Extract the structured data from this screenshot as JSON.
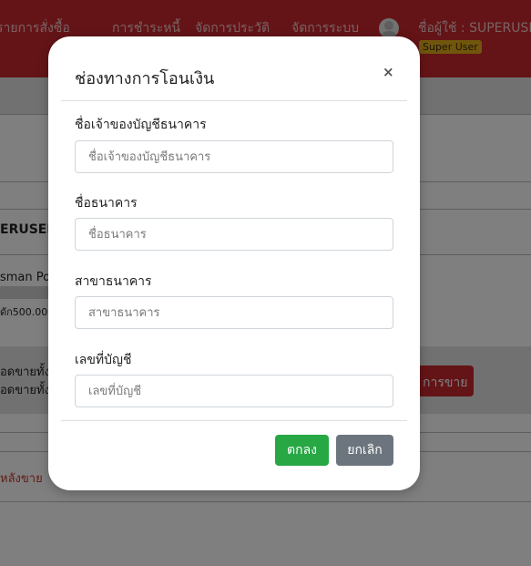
{
  "navbar": {
    "menu": [
      "รายการสั่งซื้อ",
      "การชำระหนี้",
      "จัดการประวัติ",
      "จัดการระบบ"
    ],
    "user_label": "ชื่อผู้ใช้ : SUPERUSER",
    "role_badge": "Super User"
  },
  "background": {
    "username": "ERUSER",
    "sales_person": "sman Po",
    "amount_line": "ดัก500.00",
    "total_line_1": "อดขายทั้ง",
    "total_line_2": "อดขายทั้ง",
    "sales_button": "การขาย",
    "back_link": "หลังขาย"
  },
  "modal": {
    "title": "ช่องทางการโอนเงิน",
    "close_symbol": "×",
    "fields": [
      {
        "label": "ชื่อเจ้าของบัญชีธนาคาร",
        "placeholder": "ชื่อเจ้าของบัญชีธนาคาร",
        "value": ""
      },
      {
        "label": "ชื่อธนาคาร",
        "placeholder": "ชื่อธนาคาร",
        "value": ""
      },
      {
        "label": "สาขาธนาคาร",
        "placeholder": "สาขาธนาคาร",
        "value": ""
      },
      {
        "label": "เลขที่บัญชี",
        "placeholder": "เลขที่บัญชี",
        "value": ""
      }
    ],
    "ok_label": "ตกลง",
    "cancel_label": "ยกเลิก"
  },
  "colors": {
    "navbar": "#c8282e",
    "badge": "#e0ad1b",
    "ok_button": "#28a745",
    "cancel_button": "#6c757d"
  },
  "icons": {
    "avatar": "user-avatar-icon",
    "close": "close-icon"
  }
}
